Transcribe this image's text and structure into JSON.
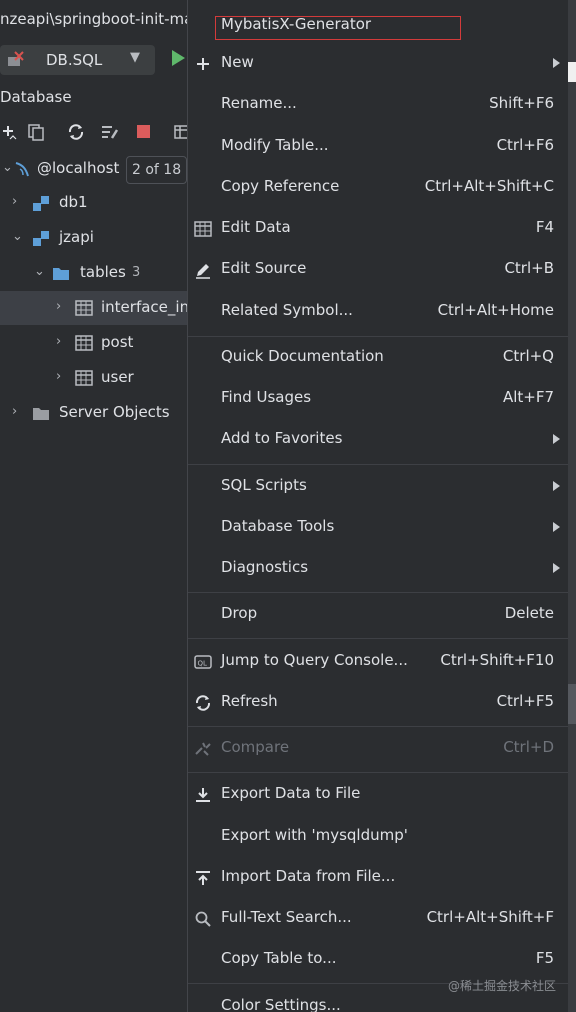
{
  "window": {
    "path": "nzeapi\\springboot-init-ma"
  },
  "toolbar": {
    "run_config": "DB.SQL"
  },
  "panel": {
    "title": "Database"
  },
  "tree": {
    "items": [
      {
        "label": "@localhost",
        "badge": "2 of 18"
      },
      {
        "label": "db1"
      },
      {
        "label": "jzapi"
      },
      {
        "label": "tables",
        "count": "3"
      },
      {
        "label": "interface_inf"
      },
      {
        "label": "post"
      },
      {
        "label": "user"
      },
      {
        "label": "Server Objects"
      }
    ]
  },
  "menu": {
    "top": "MybatisX-Generator",
    "items": [
      {
        "label": "New",
        "shortcut": ""
      },
      {
        "label": "Rename...",
        "shortcut": "Shift+F6"
      },
      {
        "label": "Modify Table...",
        "shortcut": "Ctrl+F6"
      },
      {
        "label": "Copy Reference",
        "shortcut": "Ctrl+Alt+Shift+C"
      },
      {
        "label": "Edit Data",
        "shortcut": "F4"
      },
      {
        "label": "Edit Source",
        "shortcut": "Ctrl+B"
      },
      {
        "label": "Related Symbol...",
        "shortcut": "Ctrl+Alt+Home"
      },
      {
        "label": "Quick Documentation",
        "shortcut": "Ctrl+Q"
      },
      {
        "label": "Find Usages",
        "shortcut": "Alt+F7"
      },
      {
        "label": "Add to Favorites",
        "shortcut": ""
      },
      {
        "label": "SQL Scripts",
        "shortcut": ""
      },
      {
        "label": "Database Tools",
        "shortcut": ""
      },
      {
        "label": "Diagnostics",
        "shortcut": ""
      },
      {
        "label": "Drop",
        "shortcut": "Delete"
      },
      {
        "label": "Jump to Query Console...",
        "shortcut": "Ctrl+Shift+F10"
      },
      {
        "label": "Refresh",
        "shortcut": "Ctrl+F5"
      },
      {
        "label": "Compare",
        "shortcut": "Ctrl+D"
      },
      {
        "label": "Export Data to File",
        "shortcut": ""
      },
      {
        "label": "Export with 'mysqldump'",
        "shortcut": ""
      },
      {
        "label": "Import Data from File...",
        "shortcut": ""
      },
      {
        "label": "Full-Text Search...",
        "shortcut": "Ctrl+Alt+Shift+F"
      },
      {
        "label": "Copy Table to...",
        "shortcut": "F5"
      },
      {
        "label": "Color Settings...",
        "shortcut": ""
      }
    ]
  },
  "watermark": "@稀土掘金技术社区",
  "colors": {
    "background": "#2b2d30",
    "selection": "#3d4046",
    "highlight_box": "#d33b3b",
    "run_green": "#5fb86b",
    "folder_blue": "#5e9fd8"
  }
}
